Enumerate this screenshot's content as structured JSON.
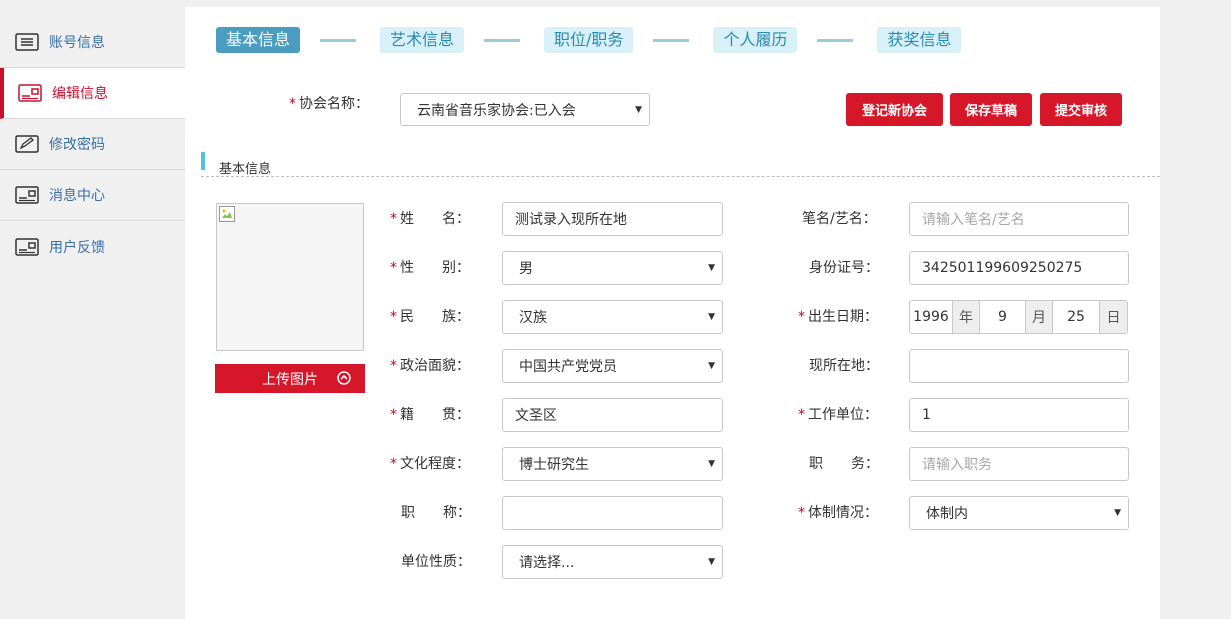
{
  "sidebar": {
    "items": [
      {
        "label": "账号信息",
        "icon": "list-icon"
      },
      {
        "label": "编辑信息",
        "icon": "card-icon"
      },
      {
        "label": "修改密码",
        "icon": "pencil-icon"
      },
      {
        "label": "消息中心",
        "icon": "card-icon"
      },
      {
        "label": "用户反馈",
        "icon": "card-icon"
      }
    ],
    "active": 1
  },
  "steps": [
    "基本信息",
    "艺术信息",
    "职位/职务",
    "个人履历",
    "获奖信息"
  ],
  "association": {
    "label": "协会名称：",
    "value": "云南省音乐家协会:已入会"
  },
  "buttons": {
    "register": "登记新协会",
    "save_draft": "保存草稿",
    "submit": "提交审核"
  },
  "section_title": "基本信息",
  "upload_label": "上传图片",
  "form": {
    "name_label": "姓　　名：",
    "name_value": "测试录入现所在地",
    "gender_label": "性　　别：",
    "gender_value": "男",
    "ethnicity_label": "民　　族：",
    "ethnicity_value": "汉族",
    "political_label": "政治面貌：",
    "political_value": "中国共产党党员",
    "native_label": "籍　　贯：",
    "native_value": "文圣区",
    "education_label": "文化程度：",
    "education_value": "博士研究生",
    "title_label": "职　　称：",
    "title_value": "",
    "unit_nature_label": "单位性质：",
    "unit_nature_value": "请选择...",
    "pen_name_label": "笔名/艺名：",
    "pen_name_placeholder": "请输入笔名/艺名",
    "id_label": "身份证号：",
    "id_value": "342501199609250275",
    "birth_label": "出生日期：",
    "birth_year": "1996",
    "birth_year_unit": "年",
    "birth_month": "9",
    "birth_month_unit": "月",
    "birth_day": "25",
    "birth_day_unit": "日",
    "location_label": "现所在地：",
    "location_value": "",
    "work_unit_label": "工作单位：",
    "work_unit_value": "1",
    "position_label": "职　　务：",
    "position_placeholder": "请输入职务",
    "system_label": "体制情况：",
    "system_value": "体制内"
  },
  "colors": {
    "accent_red": "#d6172a",
    "step_active": "#4a9cc0",
    "step_inactive": "#d8f0f7",
    "link_blue": "#3a6ea5"
  }
}
